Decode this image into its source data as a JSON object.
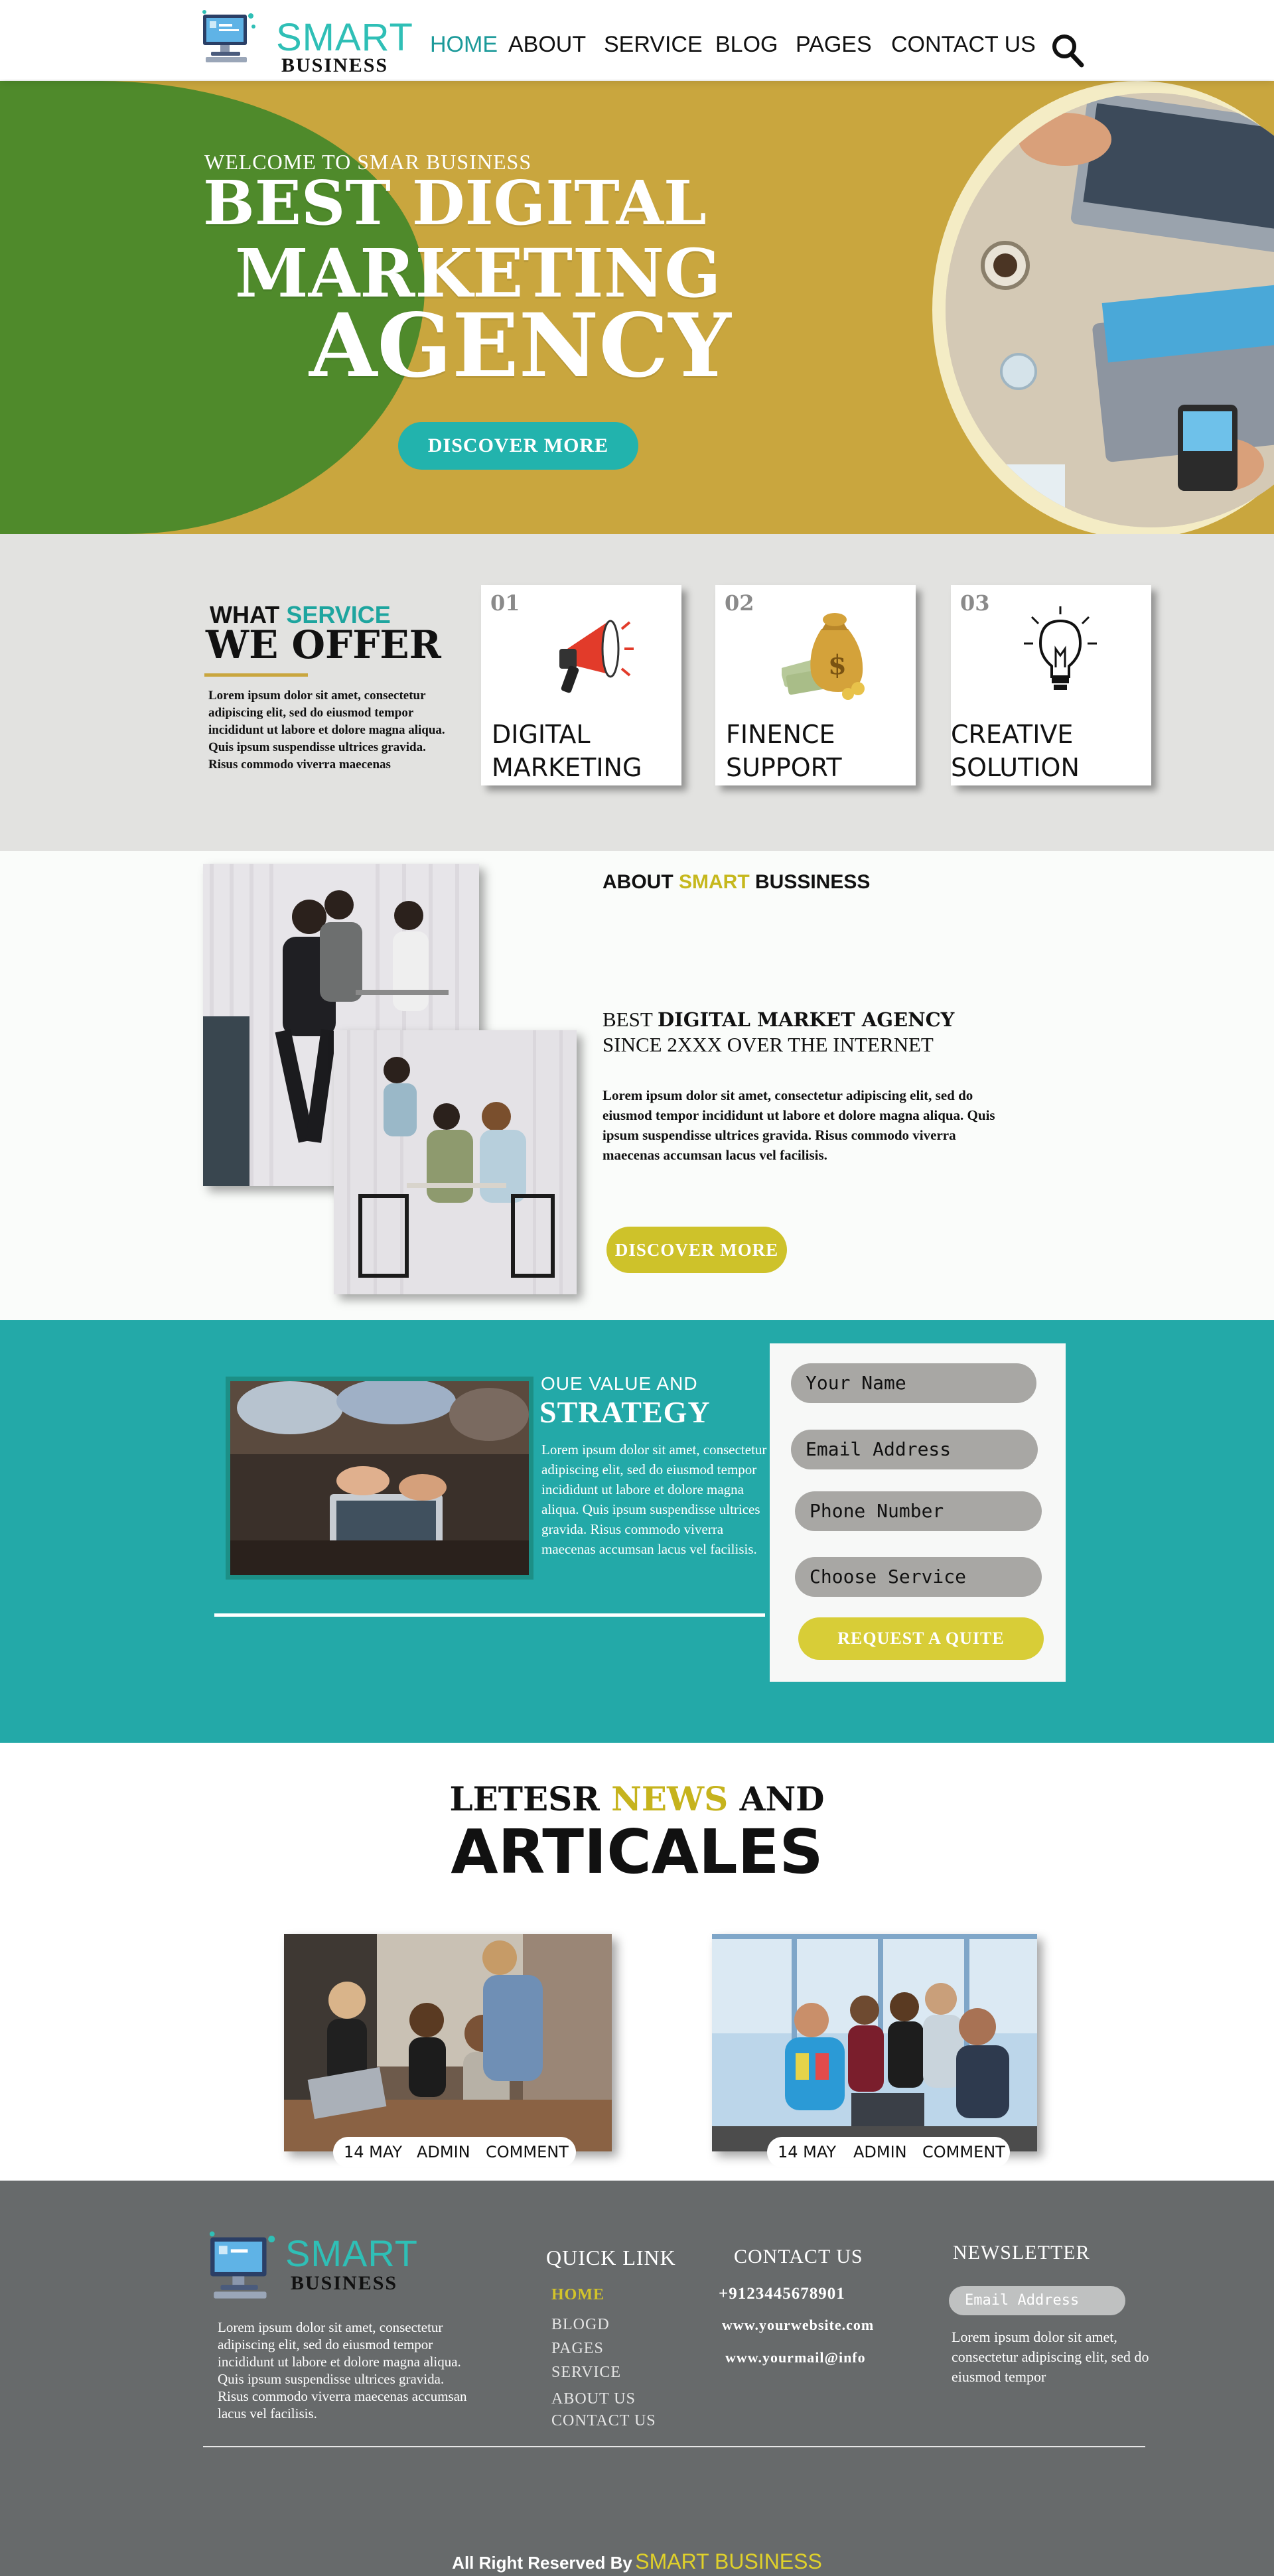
{
  "colors": {
    "teal": "#23a9a8",
    "logo_teal": "#2fbfb6",
    "mustard": "#c9a63e",
    "green": "#4f8a2b",
    "yellow": "#d9cb2c",
    "footer_gray": "#676a6b",
    "section_gray": "#e2e2e0"
  },
  "header": {
    "logo": {
      "smart": "SMART",
      "business": "BUSINESS",
      "icon": "computer-monitor-icon"
    },
    "nav": [
      {
        "label": "HOME",
        "active": true
      },
      {
        "label": "ABOUT",
        "active": false
      },
      {
        "label": "SERVICE",
        "active": false
      },
      {
        "label": "BLOG",
        "active": false
      },
      {
        "label": "PAGES",
        "active": false
      },
      {
        "label": "CONTACT US",
        "active": false
      }
    ],
    "search_icon": "search-icon"
  },
  "hero": {
    "welcome": "WELCOME TO SMAR BUSINESS",
    "line1": "BEST DIGITAL",
    "line2": "MARKETING",
    "line3": "AGENCY",
    "button": "DISCOVER MORE"
  },
  "services": {
    "heading_what": "WHAT",
    "heading_service": "SERVICE",
    "heading_offer": "WE OFFER",
    "text": "Lorem ipsum dolor sit amet, consectetur adipiscing elit, sed do eiusmod tempor incididunt ut labore et dolore magna aliqua. Quis ipsum suspendisse ultrices gravida. Risus commodo viverra maecenas",
    "cards": [
      {
        "num": "01",
        "line1": "DIGITAL",
        "line2": "MARKETING",
        "icon": "megaphone-icon"
      },
      {
        "num": "02",
        "line1": "FINENCE",
        "line2": "SUPPORT",
        "icon": "money-bag-icon"
      },
      {
        "num": "03",
        "line1": "CREATIVE",
        "line2": "SOLUTION",
        "icon": "lightbulb-icon"
      }
    ]
  },
  "about": {
    "heading_about": "ABOUT",
    "heading_smart": "SMART",
    "heading_business": "BUSSINESS",
    "sub_best": "BEST",
    "sub_bold": "DIGITAL MARKET AGENCY",
    "sub_line2": "SINCE 2XXX OVER THE INTERNET",
    "text": "Lorem ipsum dolor sit amet, consectetur adipiscing elit, sed do eiusmod tempor incididunt ut labore et dolore magna aliqua. Quis ipsum suspendisse ultrices gravida. Risus commodo viverra maecenas accumsan lacus vel facilisis.",
    "button": "DISCOVER MORE"
  },
  "strategy": {
    "kicker": "OUE VALUE AND",
    "title": "STRATEGY",
    "text": "Lorem ipsum dolor sit amet, consectetur adipiscing elit, sed do eiusmod tempor incididunt ut labore et dolore magna aliqua. Quis ipsum suspendisse ultrices gravida. Risus commodo viverra maecenas accumsan lacus vel facilisis.",
    "form": {
      "name": "Your Name",
      "email": "Email Address",
      "phone": "Phone Number",
      "service": "Choose Service",
      "button": "REQUEST A QUITE"
    }
  },
  "news": {
    "heading_a": "LETESR",
    "heading_news": "NEWS",
    "heading_and": "AND",
    "heading_b": "ARTICALES",
    "posts": [
      {
        "date": "14 MAY",
        "author": "ADMIN",
        "comment": "COMMENT"
      },
      {
        "date": "14 MAY",
        "author": "ADMIN",
        "comment": "COMMENT"
      }
    ]
  },
  "footer": {
    "logo": {
      "smart": "SMART",
      "business": "BUSINESS"
    },
    "about_text": "Lorem ipsum dolor sit amet, consectetur adipiscing elit, sed do eiusmod tempor incididunt ut labore et dolore magna aliqua. Quis ipsum suspendisse ultrices gravida. Risus commodo viverra maecenas accumsan lacus vel facilisis.",
    "quick_link_title": "QUICK LINK",
    "quick_links": [
      "HOME",
      "BLOGD",
      "PAGES",
      "SERVICE",
      "ABOUT US",
      "CONTACT US"
    ],
    "contact_title": "CONTACT US",
    "phone": "+9123445678901",
    "website": "www.yourwebsite.com",
    "email": "www.yourmail@info",
    "newsletter_title": "NEWSLETTER",
    "newsletter_placeholder": "Email Address",
    "newsletter_text": "Lorem ipsum dolor sit amet, consectetur adipiscing elit, sed do eiusmod tempor",
    "copyright": "All Right Reserved By",
    "copyright_brand": "SMART BUSINESS"
  }
}
